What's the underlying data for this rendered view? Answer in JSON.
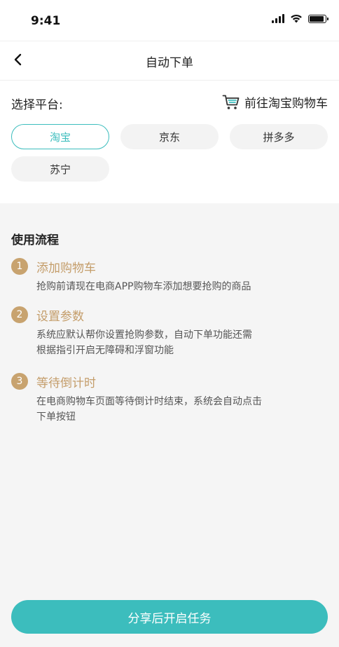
{
  "status_bar": {
    "time": "9:41"
  },
  "nav": {
    "title": "自动下单"
  },
  "platform": {
    "label": "选择平台:",
    "cart_link": "前往淘宝购物车",
    "options": [
      "淘宝",
      "京东",
      "拼多多",
      "苏宁"
    ],
    "selected": "淘宝"
  },
  "flow": {
    "title": "使用流程",
    "steps": [
      {
        "number": "1",
        "title": "添加购物车",
        "desc_lines": [
          "抢购前请现在电商APP购物车添加想要抢购的商品"
        ]
      },
      {
        "number": "2",
        "title": "设置参数",
        "desc_lines": [
          "系统应默认帮你设置抢购参数，自动下单功能还需",
          "根据指引开启无障碍和浮窗功能"
        ]
      },
      {
        "number": "3",
        "title": "等待倒计时",
        "desc_lines": [
          "在电商购物车页面等待倒计时结束，系统会自动点击",
          "下单按钮"
        ]
      }
    ]
  },
  "cta": {
    "label": "分享后开启任务"
  },
  "colors": {
    "accent": "#3cbdbd",
    "step_gold": "#c8a36f",
    "background": "#f5f5f5"
  }
}
